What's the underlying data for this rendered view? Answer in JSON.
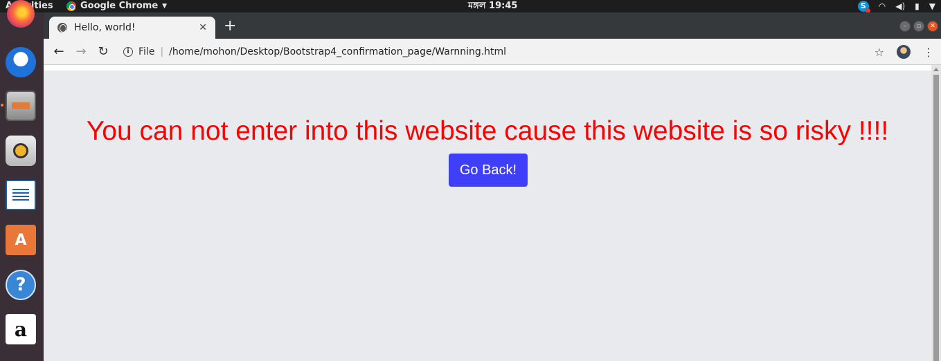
{
  "topbar": {
    "activities": "Activities",
    "app_name": "Google Chrome",
    "clock": "মঙ্গল 19:45"
  },
  "dock": {
    "items": [
      "firefox-icon",
      "thunderbird-icon",
      "files-icon",
      "rhythmbox-icon",
      "libreoffice-writer-icon",
      "software-center-icon",
      "help-icon",
      "amazon-icon"
    ]
  },
  "browser": {
    "tab_title": "Hello, world!",
    "new_tab": "+",
    "origin_label": "File",
    "separator": "|",
    "url": "/home/mohon/Desktop/Bootstrap4_confirmation_page/Warnning.html"
  },
  "page": {
    "warning_text": "You can not enter into this website cause this website is so risky !!!!",
    "button_label": "Go Back!",
    "warning_color": "#ff0000",
    "button_color": "#3f3ffa"
  }
}
